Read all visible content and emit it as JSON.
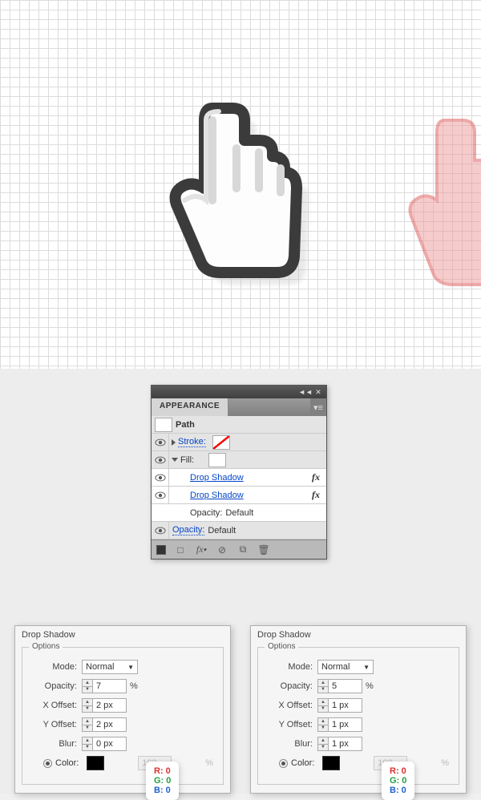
{
  "appearance": {
    "title": "APPEARANCE",
    "path_label": "Path",
    "stroke_label": "Stroke:",
    "fill_label": "Fill:",
    "effect1": "Drop Shadow",
    "effect2": "Drop Shadow",
    "opacity_label": "Opacity:",
    "opacity_value": "Default",
    "outer_opacity_label": "Opacity:",
    "outer_opacity_value": "Default",
    "fx": "fx"
  },
  "dialog1": {
    "title": "Drop Shadow",
    "options": "Options",
    "mode_label": "Mode:",
    "mode_value": "Normal",
    "opacity_label": "Opacity:",
    "opacity_value": "7",
    "pct": "%",
    "xoff_label": "X Offset:",
    "xoff_value": "2 px",
    "yoff_label": "Y Offset:",
    "yoff_value": "2 px",
    "blur_label": "Blur:",
    "blur_value": "0 px",
    "color_label": "Color:",
    "dark_value": "100",
    "rgb": {
      "r": "R: 0",
      "g": "G: 0",
      "b": "B: 0"
    }
  },
  "dialog2": {
    "title": "Drop Shadow",
    "options": "Options",
    "mode_label": "Mode:",
    "mode_value": "Normal",
    "opacity_label": "Opacity:",
    "opacity_value": "5",
    "pct": "%",
    "xoff_label": "X Offset:",
    "xoff_value": "1 px",
    "yoff_label": "Y Offset:",
    "yoff_value": "1 px",
    "blur_label": "Blur:",
    "blur_value": "1 px",
    "color_label": "Color:",
    "dark_value": "100",
    "rgb": {
      "r": "R: 0",
      "g": "G: 0",
      "b": "B: 0"
    }
  }
}
